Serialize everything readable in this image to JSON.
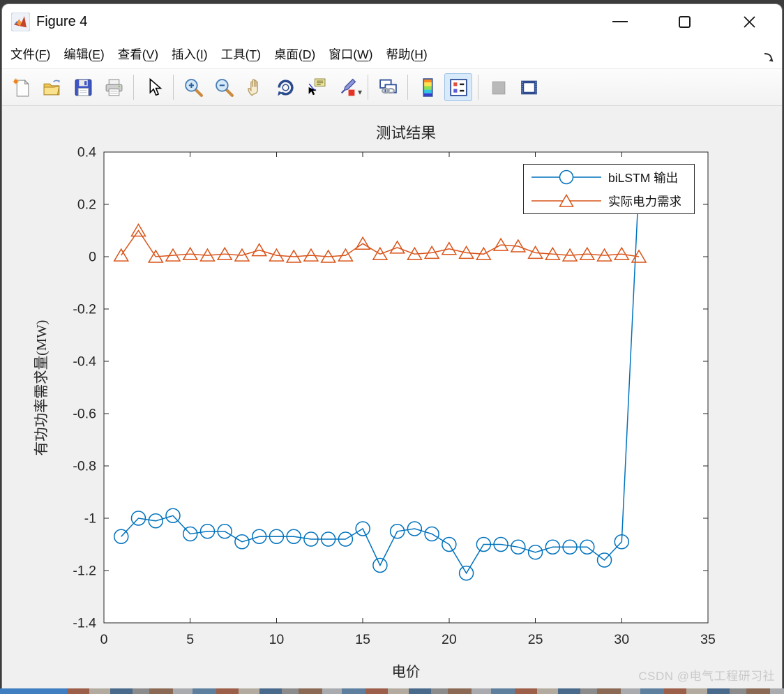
{
  "window": {
    "title": "Figure 4",
    "controls": {
      "minimize": "minimize",
      "maximize": "maximize",
      "close": "close"
    }
  },
  "menu_bar": {
    "items": [
      {
        "name": "file",
        "label": "文件",
        "mnemonic": "F"
      },
      {
        "name": "edit",
        "label": "编辑",
        "mnemonic": "E"
      },
      {
        "name": "view",
        "label": "查看",
        "mnemonic": "V"
      },
      {
        "name": "insert",
        "label": "插入",
        "mnemonic": "I"
      },
      {
        "name": "tools",
        "label": "工具",
        "mnemonic": "T"
      },
      {
        "name": "desktop",
        "label": "桌面",
        "mnemonic": "D"
      },
      {
        "name": "window",
        "label": "窗口",
        "mnemonic": "W"
      },
      {
        "name": "help",
        "label": "帮助",
        "mnemonic": "H"
      }
    ]
  },
  "toolbar": {
    "buttons": [
      {
        "type": "button",
        "icon": "new-figure-icon"
      },
      {
        "type": "button",
        "icon": "open-file-icon"
      },
      {
        "type": "button",
        "icon": "save-figure-icon"
      },
      {
        "type": "button",
        "icon": "print-figure-icon"
      },
      {
        "type": "separator"
      },
      {
        "type": "button",
        "icon": "edit-plot-pointer-icon"
      },
      {
        "type": "separator"
      },
      {
        "type": "button",
        "icon": "zoom-in-icon"
      },
      {
        "type": "button",
        "icon": "zoom-out-icon"
      },
      {
        "type": "button",
        "icon": "pan-hand-icon"
      },
      {
        "type": "button",
        "icon": "rotate-3d-icon"
      },
      {
        "type": "button",
        "icon": "data-cursor-icon"
      },
      {
        "type": "button",
        "icon": "brush-data-icon",
        "dropdown": true
      },
      {
        "type": "separator"
      },
      {
        "type": "button",
        "icon": "link-plot-icon"
      },
      {
        "type": "separator"
      },
      {
        "type": "button",
        "icon": "insert-colorbar-icon"
      },
      {
        "type": "button",
        "icon": "insert-legend-icon",
        "state": "selected"
      },
      {
        "type": "separator"
      },
      {
        "type": "button",
        "icon": "hide-plot-tools-icon",
        "state": "disabled"
      },
      {
        "type": "button",
        "icon": "show-plot-tools-icon"
      }
    ]
  },
  "figure": {
    "watermark": "CSDN @电气工程研习社"
  },
  "chart_data": {
    "type": "line",
    "title": "测试结果",
    "xlabel": "电价",
    "ylabel": "有功功率需求量(MW)",
    "xlim": [
      0,
      35
    ],
    "ylim": [
      -1.4,
      0.4
    ],
    "xticks": [
      0,
      5,
      10,
      15,
      20,
      25,
      30,
      35
    ],
    "yticks": [
      0.4,
      0.2,
      0,
      -0.2,
      -0.4,
      -0.6,
      -0.8,
      -1,
      -1.2,
      -1.4
    ],
    "grid": false,
    "box": true,
    "legend_position": "top-right",
    "axis_color": "#262626",
    "x": [
      1,
      2,
      3,
      4,
      5,
      6,
      7,
      8,
      9,
      10,
      11,
      12,
      13,
      14,
      15,
      16,
      17,
      18,
      19,
      20,
      21,
      22,
      23,
      24,
      25,
      26,
      27,
      28,
      29,
      30,
      31
    ],
    "series": [
      {
        "name": "biLSTM 输出",
        "color": "#0072BD",
        "marker": "circle",
        "values": [
          -1.07,
          -1.0,
          -1.01,
          -0.99,
          -1.06,
          -1.05,
          -1.05,
          -1.09,
          -1.07,
          -1.07,
          -1.07,
          -1.08,
          -1.08,
          -1.08,
          -1.04,
          -1.18,
          -1.05,
          -1.04,
          -1.06,
          -1.1,
          -1.21,
          -1.1,
          -1.1,
          -1.11,
          -1.13,
          -1.11,
          -1.11,
          -1.11,
          -1.16,
          -1.09,
          0.28
        ]
      },
      {
        "name": "实际电力需求",
        "color": "#D95319",
        "marker": "triangle",
        "values": [
          0.005,
          0.1,
          0.0,
          0.005,
          0.01,
          0.005,
          0.01,
          0.005,
          0.025,
          0.005,
          0.0,
          0.005,
          0.0,
          0.005,
          0.05,
          0.01,
          0.035,
          0.01,
          0.015,
          0.03,
          0.015,
          0.01,
          0.045,
          0.04,
          0.015,
          0.01,
          0.005,
          0.01,
          0.005,
          0.01,
          0.0
        ]
      }
    ]
  }
}
